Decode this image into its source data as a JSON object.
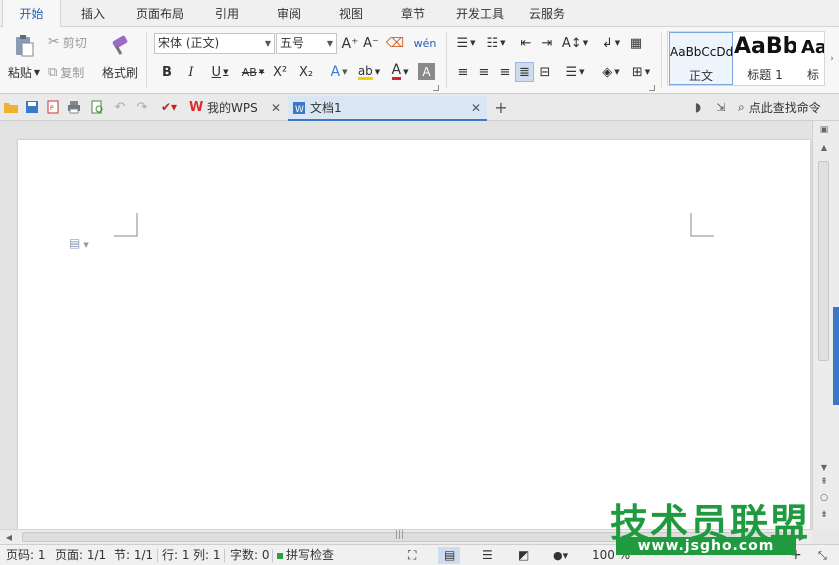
{
  "menu_tabs": [
    "开始",
    "插入",
    "页面布局",
    "引用",
    "审阅",
    "视图",
    "章节",
    "开发工具",
    "云服务"
  ],
  "ribbon": {
    "paste_label": "粘贴",
    "cut_label": "剪切",
    "copy_label": "复制",
    "format_painter_label": "格式刷",
    "font_name": "宋体 (正文)",
    "font_size": "五号",
    "styles": [
      {
        "sample": "AaBbCcDd",
        "name": "正文"
      },
      {
        "sample": "AaBb",
        "name": "标题 1"
      },
      {
        "sample": "Aa",
        "name": "标"
      }
    ]
  },
  "quickbar": {
    "tabs": [
      {
        "label": "我的WPS"
      },
      {
        "label": "文档1"
      }
    ],
    "find_command": "点此查找命令"
  },
  "status": {
    "page_code": "页码: 1",
    "page_count": "页面: 1/1",
    "section": "节: 1/1",
    "row": "行: 1",
    "column": "列: 1",
    "word_count": "字数: 0",
    "spell_check": "拼写检查",
    "zoom": "100 %"
  },
  "watermark": {
    "text": "技术员联盟",
    "url": "www.jsgho.com"
  },
  "colors": {
    "accent": "#2a5fb0",
    "watermark_green": "#1f9a3e",
    "font_color_red": "#e02020",
    "highlight_yellow": "#f2d200"
  }
}
